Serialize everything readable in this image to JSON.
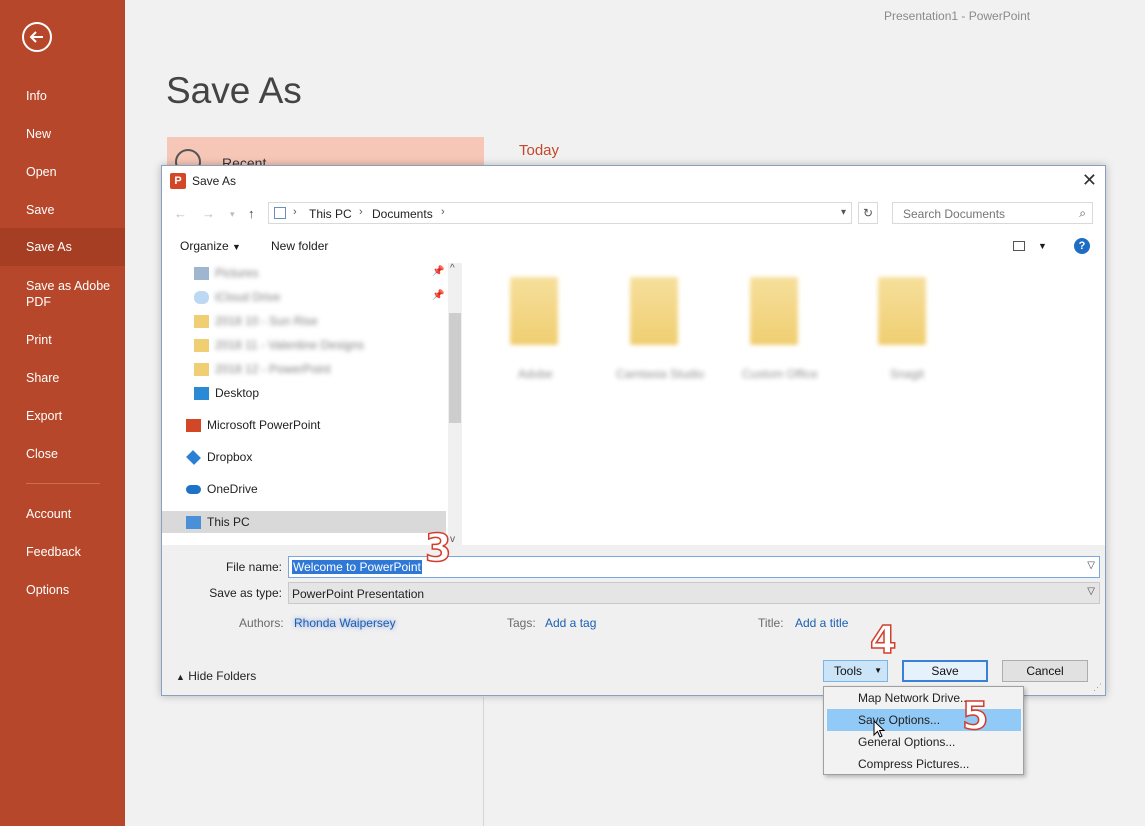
{
  "app_title": "Presentation1  -  PowerPoint",
  "sidebar": {
    "items": [
      {
        "label": "Info",
        "top": 0
      },
      {
        "label": "New"
      },
      {
        "label": "Open"
      },
      {
        "label": "Save"
      },
      {
        "label": "Save As",
        "active": true
      },
      {
        "label": "Save as Adobe PDF"
      },
      {
        "label": "Print"
      },
      {
        "label": "Share"
      },
      {
        "label": "Export"
      },
      {
        "label": "Close"
      },
      {
        "label": "Account"
      },
      {
        "label": "Feedback"
      },
      {
        "label": "Options"
      }
    ]
  },
  "backstage": {
    "page_title": "Save As",
    "recent_label": "Recent",
    "today_label": "Today"
  },
  "dialog": {
    "title": "Save As",
    "address": {
      "crumbs": [
        "This PC",
        "Documents"
      ]
    },
    "search_placeholder": "Search Documents",
    "toolbar": {
      "organize": "Organize",
      "new_folder": "New folder"
    },
    "nav_items": [
      {
        "label": "Desktop"
      },
      {
        "label": "Microsoft PowerPoint"
      },
      {
        "label": "Dropbox"
      },
      {
        "label": "OneDrive"
      },
      {
        "label": "This PC",
        "selected": true
      }
    ],
    "form": {
      "file_name_label": "File name:",
      "file_name_value": "Welcome to PowerPoint",
      "save_type_label": "Save as type:",
      "save_type_value": "PowerPoint Presentation",
      "authors_label": "Authors:",
      "tags_label": "Tags:",
      "tags_link": "Add a tag",
      "title_label": "Title:",
      "title_link": "Add a title"
    },
    "buttons": {
      "hide_folders": "Hide Folders",
      "tools": "Tools",
      "save": "Save",
      "cancel": "Cancel"
    },
    "tools_menu": [
      "Map Network Drive...",
      "Save Options...",
      "General Options...",
      "Compress Pictures..."
    ]
  },
  "annotations": {
    "step3": "3",
    "step4": "4",
    "step5": "5"
  },
  "colors": {
    "sidebar": "#b7472a",
    "accent": "#c4482a",
    "selection": "#3078d6",
    "menu_highlight": "#91c9f7"
  }
}
